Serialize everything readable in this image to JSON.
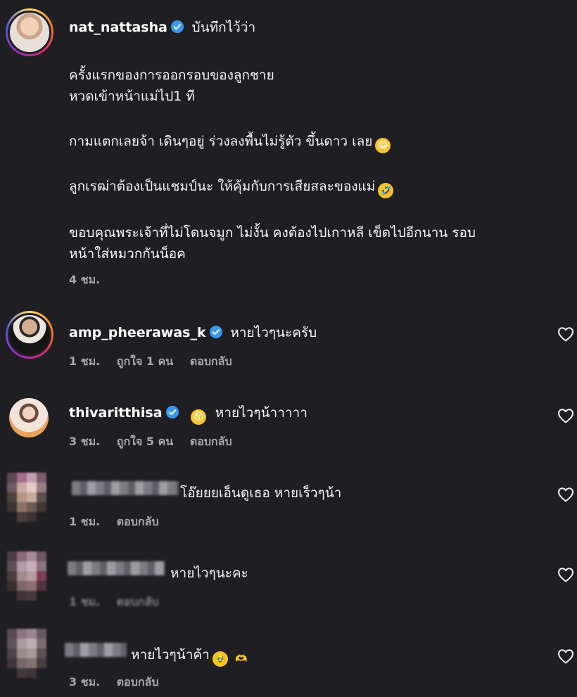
{
  "post": {
    "username": "nat_nattasha",
    "verified": true,
    "header_text": "บันทึกไว้ว่า",
    "caption_lines": [
      "ครั้งแรกของการออกรอบของลูกชาย",
      "หวดเข้าหน้าแม่ไป1 ที",
      "กามแตกเลยจ้า เดินๆอยู่ ร่วงลงพื้นไม่รู้ตัว ขึ้นดาว เลย",
      "ลูกเรฒ่าต้องเป็นแชมป์นะ ให้คุ้มกับการเสียสละของแม่",
      "ขอบคุณพระเจ้าที่ไม่โดนจมูก ไม่งั้น คงต้องไปเกาหลี เข็ดไปอีกนาน รอบ",
      "หน้าใส่หมวกกันน็อค"
    ],
    "time": "4 ชม."
  },
  "comments": [
    {
      "username": "amp_pheerawas_k",
      "verified": true,
      "text": "หายไวๆนะครับ",
      "time": "1 ชม.",
      "likes": "ถูกใจ 1 คน",
      "reply": "ตอบกลับ"
    },
    {
      "username": "thivaritthisa",
      "verified": true,
      "text": "หายไวๆน้าาาาา",
      "time": "3 ชม.",
      "likes": "ถูกใจ 5 คน",
      "reply": "ตอบกลับ"
    },
    {
      "username": "",
      "text": "โอ๊ยยยเอ็นดูเธอ หายเร็วๆน้า",
      "time": "1 ชม.",
      "reply": "ตอบกลับ"
    },
    {
      "username": "",
      "text": "หายไวๆนะคะ",
      "time": "1 ชม.",
      "reply": "ตอบกลับ"
    },
    {
      "username": "",
      "text": "หายไวๆน้าค้า",
      "time": "3 ชม.",
      "reply": "ตอบกลับ"
    }
  ],
  "colors": {
    "background": "#1f1f23",
    "verified": "#3897f0",
    "meta": "#a8a8a8"
  }
}
